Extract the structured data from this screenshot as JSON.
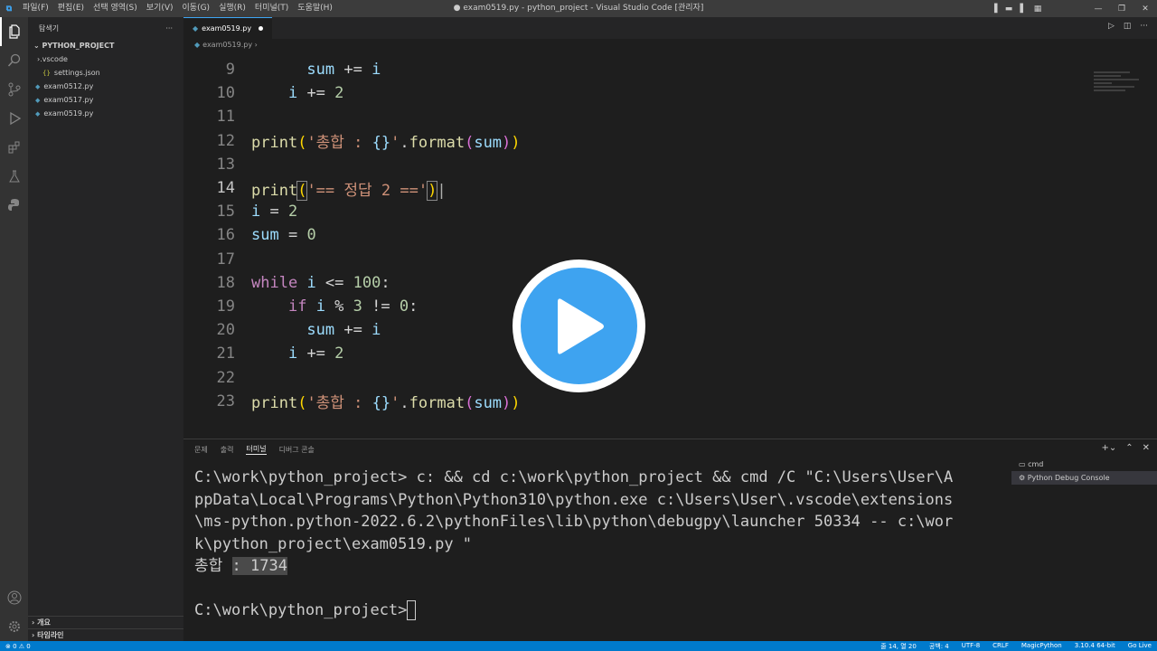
{
  "titlebar": {
    "menus": [
      "파일(F)",
      "편집(E)",
      "선택 영역(S)",
      "보기(V)",
      "이동(G)",
      "실행(R)",
      "터미널(T)",
      "도움말(H)"
    ],
    "title": "● exam0519.py - python_project - Visual Studio Code [관리자]"
  },
  "sidebar": {
    "title": "탐색기",
    "project": "PYTHON_PROJECT",
    "folder": ".vscode",
    "settings": "settings.json",
    "files": [
      "exam0512.py",
      "exam0517.py",
      "exam0519.py"
    ],
    "outline": "개요",
    "timeline": "타임라인"
  },
  "editor": {
    "tab": "exam0519.py",
    "breadcrumb": "exam0519.py ›"
  },
  "code_lines": [
    "9",
    "10",
    "11",
    "12",
    "13",
    "14",
    "15",
    "16",
    "17",
    "18",
    "19",
    "20",
    "21",
    "22",
    "23"
  ],
  "panel": {
    "tabs": [
      "문제",
      "출력",
      "터미널",
      "디버그 콘솔"
    ],
    "terminal_lines": [
      "C:\\work\\python_project> c: && cd c:\\work\\python_project && cmd /C \"C:\\Users\\User\\A",
      "ppData\\Local\\Programs\\Python\\Python310\\python.exe c:\\Users\\User\\.vscode\\extensions",
      "\\ms-python.python-2022.6.2\\pythonFiles\\lib\\python\\debugpy\\launcher 50334 -- c:\\wor",
      "k\\python_project\\exam0519.py \""
    ],
    "output_label": "총합",
    "output_value": ": 1734",
    "prompt": "C:\\work\\python_project>",
    "terminals": [
      "cmd",
      "Python Debug Console"
    ]
  },
  "statusbar": {
    "left": "⊗ 0 ⚠ 0",
    "position": "줄 14, 열 20",
    "spaces": "공백: 4",
    "encoding": "UTF-8",
    "eol": "CRLF",
    "lang": "MagicPython",
    "interpreter": "3.10.4 64-bit",
    "golive": "Go Live"
  }
}
